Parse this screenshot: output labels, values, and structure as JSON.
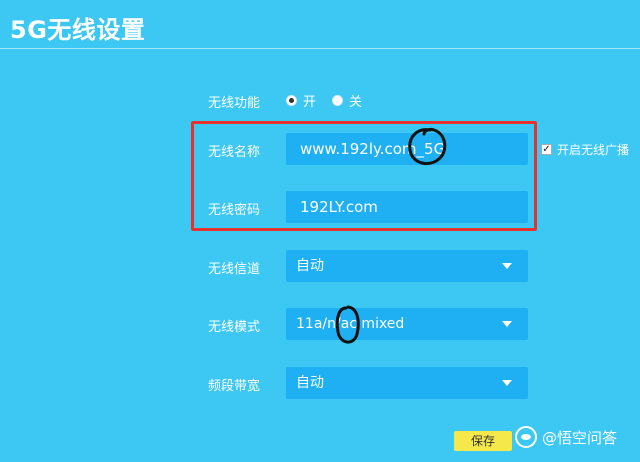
{
  "page": {
    "title": "5G无线设置"
  },
  "wireless_function": {
    "label": "无线功能",
    "options": [
      "开",
      "关"
    ],
    "selected": "开"
  },
  "ssid": {
    "label": "无线名称",
    "value": "www.192ly.com_5G",
    "broadcast_label": "开启无线广播",
    "broadcast_checked": true
  },
  "password": {
    "label": "无线密码",
    "value": "192LY.com"
  },
  "channel": {
    "label": "无线信道",
    "value": "自动"
  },
  "mode": {
    "label": "无线模式",
    "value": "11a/n/ac mixed"
  },
  "bandwidth": {
    "label": "频段带宽",
    "value": "自动"
  },
  "actions": {
    "save_label": "保存"
  },
  "watermark": {
    "text": "@悟空问答"
  },
  "colors": {
    "background": "#3dc8f4",
    "field": "#1fb0f4",
    "highlight_box": "#e5322d",
    "save_button": "#f4e84a"
  }
}
